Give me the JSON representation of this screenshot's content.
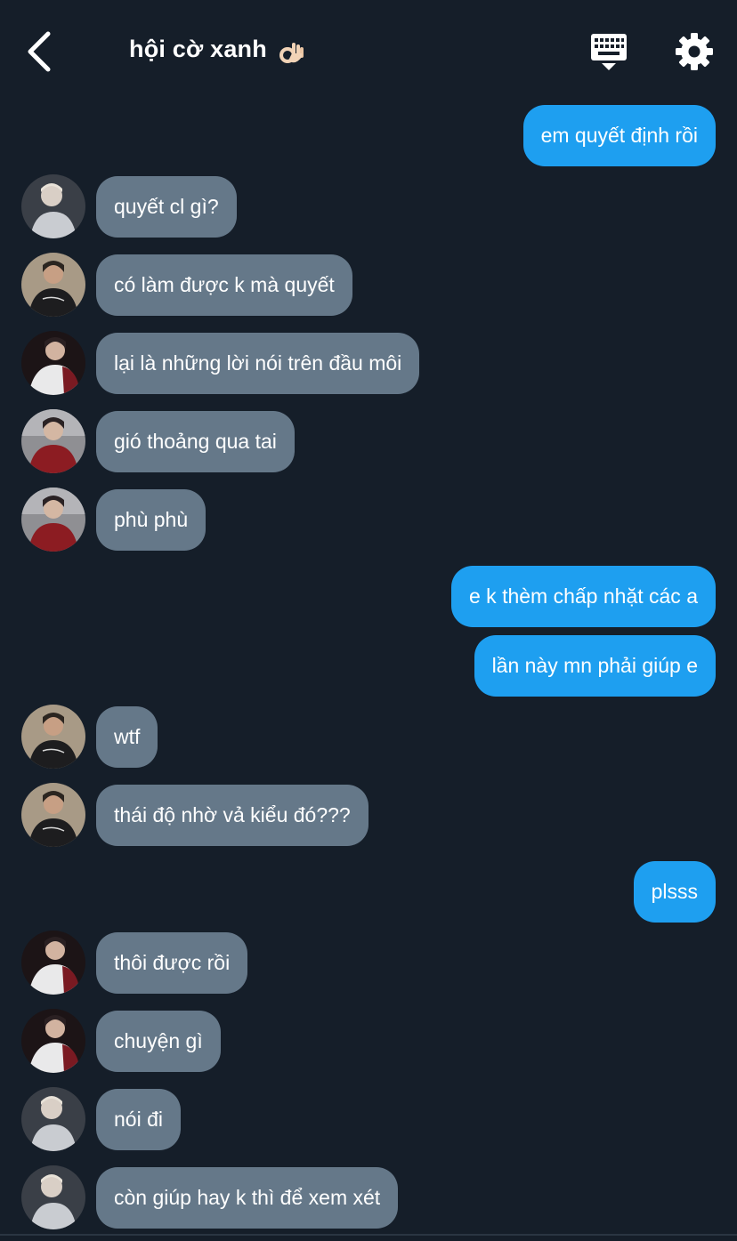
{
  "header": {
    "title": "hội cờ xanh",
    "title_emoji": "ok-hand-emoji",
    "back_icon": "chevron-left-icon",
    "keyboard_icon": "keyboard-icon",
    "settings_icon": "gear-icon"
  },
  "colors": {
    "background": "#151e29",
    "incoming_bubble": "#657889",
    "outgoing_bubble": "#1e9ff0"
  },
  "messages": [
    {
      "side": "out",
      "text": "em quyết định rồi"
    },
    {
      "side": "in",
      "sender": "gray-hoodie-avatar",
      "text": "quyết cl gì?"
    },
    {
      "side": "in",
      "sender": "black-jacket-avatar",
      "text": "có làm được k mà quyết"
    },
    {
      "side": "in",
      "sender": "red-white-jacket-avatar",
      "text": "lại là những lời nói trên đầu môi"
    },
    {
      "side": "in",
      "sender": "red-jacket-avatar",
      "text": "gió thoảng qua tai"
    },
    {
      "side": "in",
      "sender": "red-jacket-avatar",
      "text": "phù phù"
    },
    {
      "side": "out",
      "text": "e k thèm chấp nhặt các a"
    },
    {
      "side": "out",
      "text": "lần này mn phải giúp e"
    },
    {
      "side": "in",
      "sender": "black-jacket-avatar",
      "text": "wtf"
    },
    {
      "side": "in",
      "sender": "black-jacket-avatar",
      "text": "thái độ nhờ vả kiểu đó???"
    },
    {
      "side": "out",
      "text": "plsss"
    },
    {
      "side": "in",
      "sender": "red-white-jacket-avatar",
      "text": "thôi được rồi"
    },
    {
      "side": "in",
      "sender": "red-white-jacket-avatar",
      "text": "chuyện gì"
    },
    {
      "side": "in",
      "sender": "gray-hoodie-avatar",
      "text": "nói đi"
    },
    {
      "side": "in",
      "sender": "gray-hoodie-avatar",
      "text": "còn giúp hay k thì để xem xét"
    }
  ]
}
